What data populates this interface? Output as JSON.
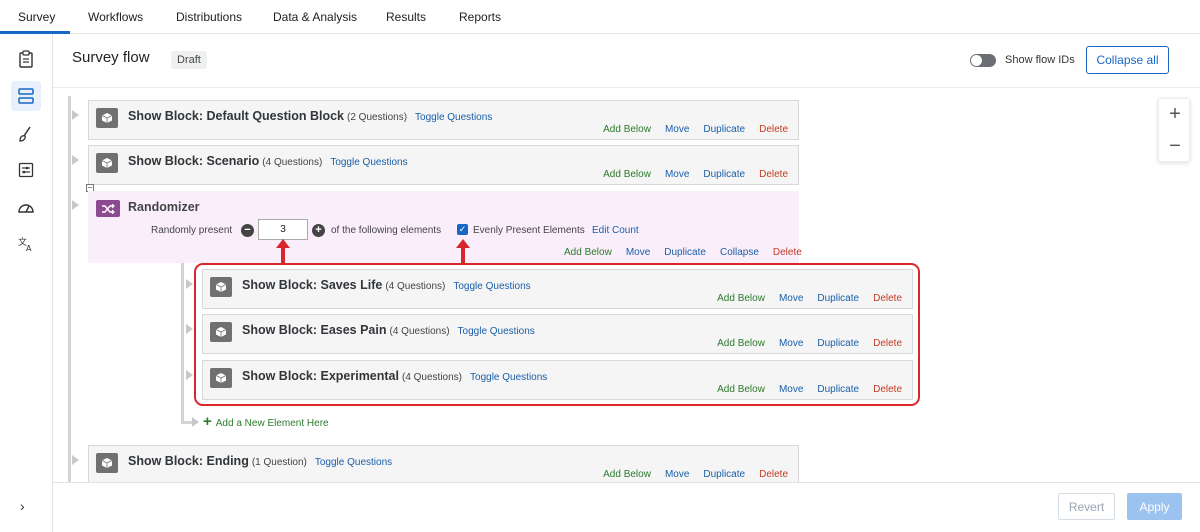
{
  "nav": {
    "tabs": [
      "Survey",
      "Workflows",
      "Distributions",
      "Data & Analysis",
      "Results",
      "Reports"
    ],
    "active": "Survey"
  },
  "sidebar": {
    "icons": [
      "survey-clipboard-icon",
      "survey-flow-icon",
      "look-and-feel-brush-icon",
      "survey-options-icon",
      "tools-gauge-icon",
      "translate-icon"
    ],
    "selected": "survey-flow-icon",
    "expand": "›"
  },
  "header": {
    "title": "Survey flow",
    "status": "Draft",
    "show_flow_ids_label": "Show flow IDs",
    "show_flow_ids_on": false,
    "collapse_all_label": "Collapse all"
  },
  "actions": {
    "add_below": "Add Below",
    "move": "Move",
    "duplicate": "Duplicate",
    "delete": "Delete",
    "collapse": "Collapse",
    "toggle_questions": "Toggle Questions"
  },
  "blocks": [
    {
      "title": "Show Block: Default Question Block",
      "count": "(2 Questions)"
    },
    {
      "title": "Show Block: Scenario",
      "count": "(4 Questions)"
    },
    {
      "title": "Show Block: Ending",
      "count": "(1 Question)"
    }
  ],
  "randomizer": {
    "title": "Randomizer",
    "randomly_present_label": "Randomly present",
    "count_value": "3",
    "of_following_label": "of the following elements",
    "evenly_present_label": "Evenly Present Elements",
    "evenly_present_checked": true,
    "edit_count_label": "Edit Count",
    "children": [
      {
        "title": "Show Block: Saves Life",
        "count": "(4 Questions)"
      },
      {
        "title": "Show Block: Eases Pain",
        "count": "(4 Questions)"
      },
      {
        "title": "Show Block: Experimental",
        "count": "(4 Questions)"
      }
    ],
    "add_element_label": "Add a New Element Here"
  },
  "zoom": {
    "in": "+",
    "out": "−"
  },
  "footer": {
    "revert_label": "Revert",
    "apply_label": "Apply"
  },
  "colors": {
    "accent": "#1668c4",
    "add_green": "#2d7a2d",
    "delete_red": "#c23b22",
    "highlight_red": "#d9262c",
    "randomizer_bg": "#fbeefb"
  }
}
